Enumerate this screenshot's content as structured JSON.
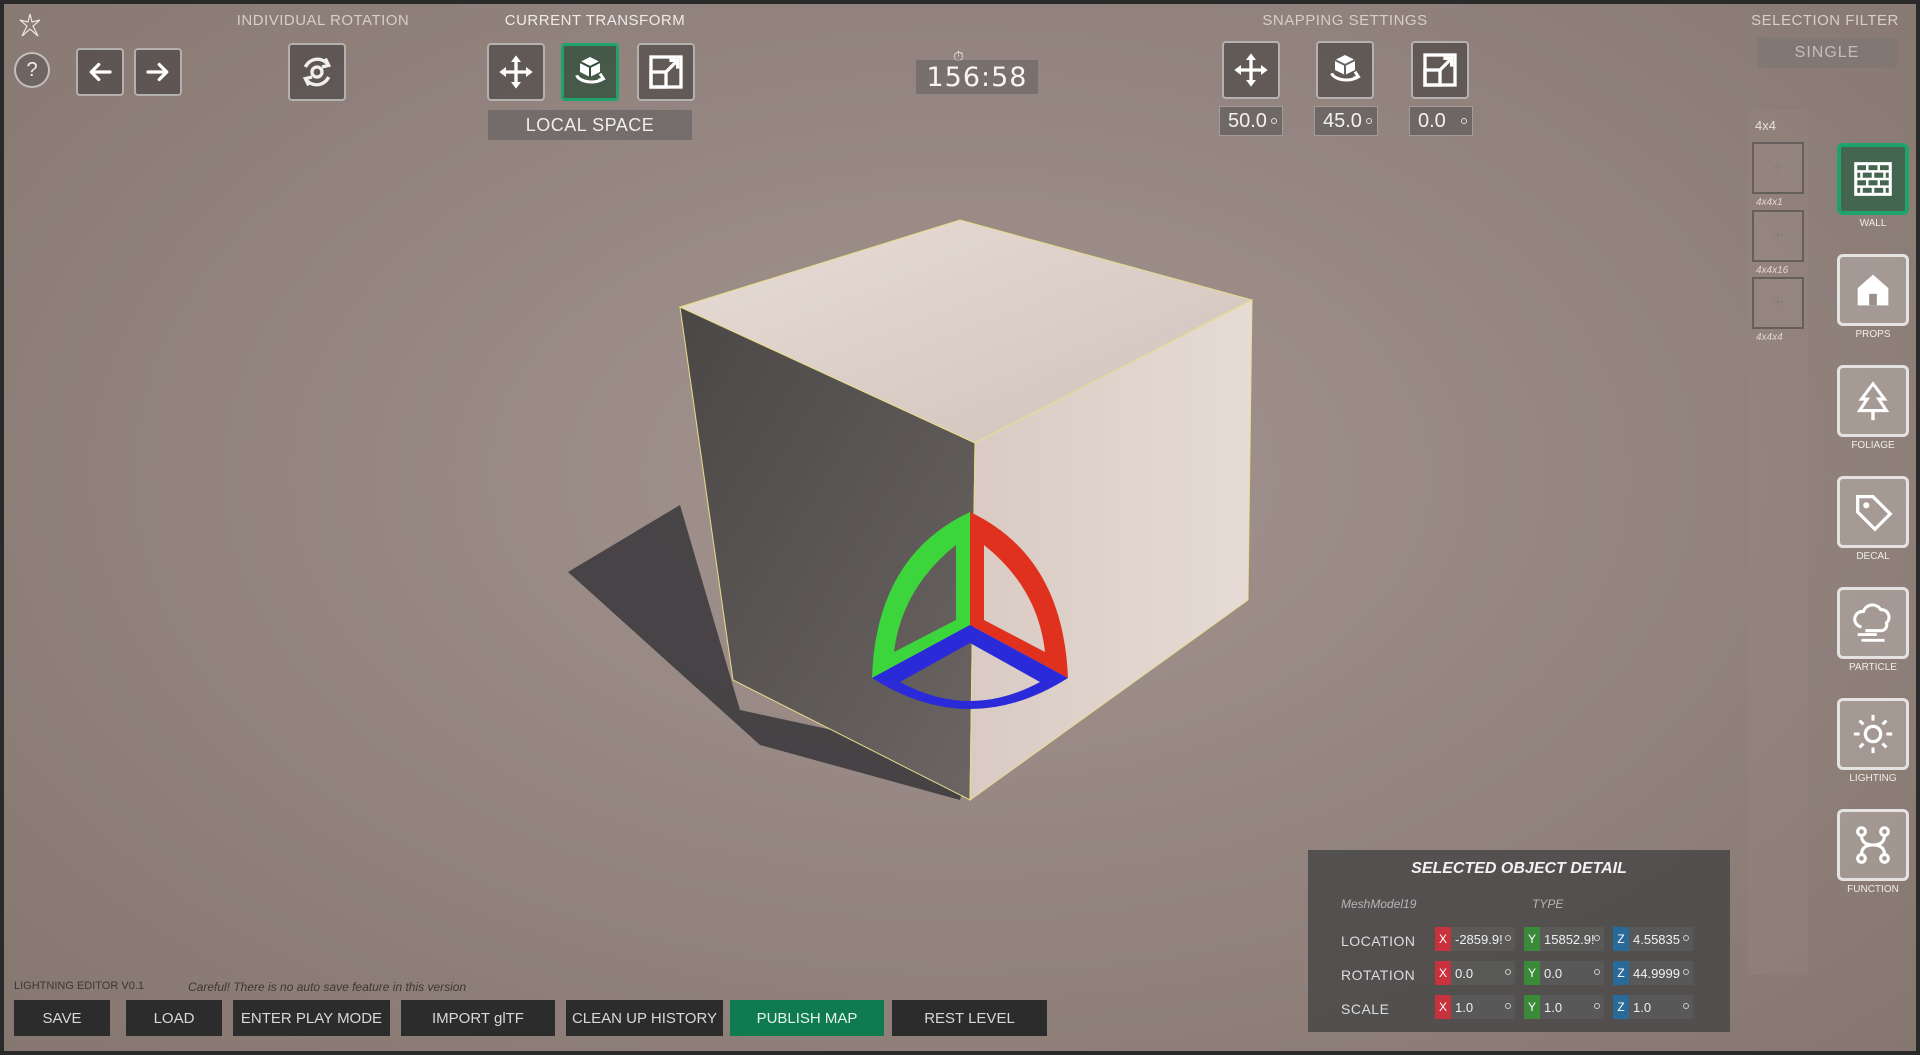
{
  "toolbar": {
    "individual_rotation_label": "INDIVIDUAL ROTATION",
    "current_transform_label": "CURRENT TRANSFORM",
    "local_space_label": "LOCAL SPACE",
    "snapping_settings_label": "SNAPPING SETTINGS",
    "selection_filter_label": "SELECTION FILTER",
    "selection_filter_value": "SINGLE",
    "help_label": "?",
    "timer": "156:58"
  },
  "snapping": {
    "translate_value": "50.0",
    "rotate_value": "45.0",
    "scale_value": "0.0"
  },
  "asset_panel": {
    "grid_label": "4x4",
    "tiles": [
      {
        "label": "4x4x1"
      },
      {
        "label": "4x4x16"
      },
      {
        "label": "4x4x4"
      }
    ]
  },
  "categories": [
    {
      "label": "WALL",
      "icon": "brick-wall-icon",
      "active": true
    },
    {
      "label": "PROPS",
      "icon": "house-icon",
      "active": false
    },
    {
      "label": "FOLIAGE",
      "icon": "tree-icon",
      "active": false
    },
    {
      "label": "DECAL",
      "icon": "tag-icon",
      "active": false
    },
    {
      "label": "PARTICLE",
      "icon": "particle-icon",
      "active": false
    },
    {
      "label": "LIGHTING",
      "icon": "sun-icon",
      "active": false
    },
    {
      "label": "FUNCTION",
      "icon": "node-graph-icon",
      "active": false
    }
  ],
  "detail": {
    "title": "SELECTED OBJECT DETAIL",
    "object_name": "MeshModel19",
    "type_label": "TYPE",
    "location_label": "LOCATION",
    "rotation_label": "ROTATION",
    "scale_label": "SCALE",
    "location": {
      "x": "-2859.9!",
      "y": "15852.9!",
      "z": "4.55835"
    },
    "rotation": {
      "x": "0.0",
      "y": "0.0",
      "z": "44.9999"
    },
    "scale": {
      "x": "1.0",
      "y": "1.0",
      "z": "1.0"
    },
    "axis": {
      "x": "X",
      "y": "Y",
      "z": "Z"
    }
  },
  "footer": {
    "version": "LIGHTNING EDITOR V0.1",
    "warning": "Careful! There is no auto save feature in this version",
    "save": "SAVE",
    "load": "LOAD",
    "enter_play_mode": "ENTER PLAY MODE",
    "import_gltf": "IMPORT glTF",
    "clean_up_history": "CLEAN UP HISTORY",
    "publish_map": "PUBLISH MAP",
    "rest_level": "REST LEVEL"
  },
  "colors": {
    "accent": "#1fa36a",
    "gizmo_x": "#e0301e",
    "gizmo_y": "#3cd63c",
    "gizmo_z": "#2a2ad8"
  }
}
